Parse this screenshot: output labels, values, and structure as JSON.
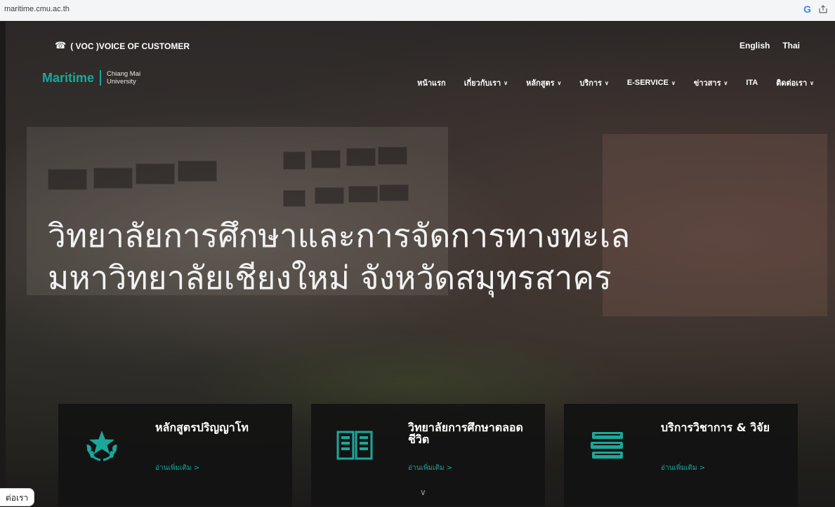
{
  "browser": {
    "url": "maritime.cmu.ac.th",
    "google_icon": "G"
  },
  "topbar": {
    "voc_label": "( VOC )VOICE OF CUSTOMER",
    "lang_en": "English",
    "lang_th": "Thai"
  },
  "logo": {
    "main": "Maritime",
    "sub_line1": "Chiang Mai",
    "sub_line2": "University"
  },
  "nav": {
    "items": [
      {
        "label": "หน้าแรก",
        "dropdown": false
      },
      {
        "label": "เกี่ยวกับเรา",
        "dropdown": true
      },
      {
        "label": "หลักสูตร",
        "dropdown": true
      },
      {
        "label": "บริการ",
        "dropdown": true
      },
      {
        "label": "E-SERVICE",
        "dropdown": true
      },
      {
        "label": "ข่าวสาร",
        "dropdown": true
      },
      {
        "label": "ITA",
        "dropdown": false
      },
      {
        "label": "ติดต่อเรา",
        "dropdown": true
      }
    ]
  },
  "hero": {
    "line1": "วิทยาลัยการศึกษาและการจัดการทางทะเล",
    "line2": "มหาวิทยาลัยเชียงใหม่ จังหวัดสมุทรสาคร"
  },
  "cards": [
    {
      "title": "หลักสูตรปริญญาโท",
      "link": "อ่านเพิ่มเติม >",
      "icon": "star-laurel-icon"
    },
    {
      "title": "วิทยาลัยการศึกษาตลอดชีวิต",
      "link": "อ่านเพิ่มเติม >",
      "icon": "open-book-icon"
    },
    {
      "title": "บริการวิชาการ & วิจัย",
      "link": "อ่านเพิ่มเติม >",
      "icon": "book-stack-icon"
    }
  ],
  "contact_tab": "ต่อเรา",
  "colors": {
    "accent": "#19a89b",
    "card_bg": "#121212"
  }
}
